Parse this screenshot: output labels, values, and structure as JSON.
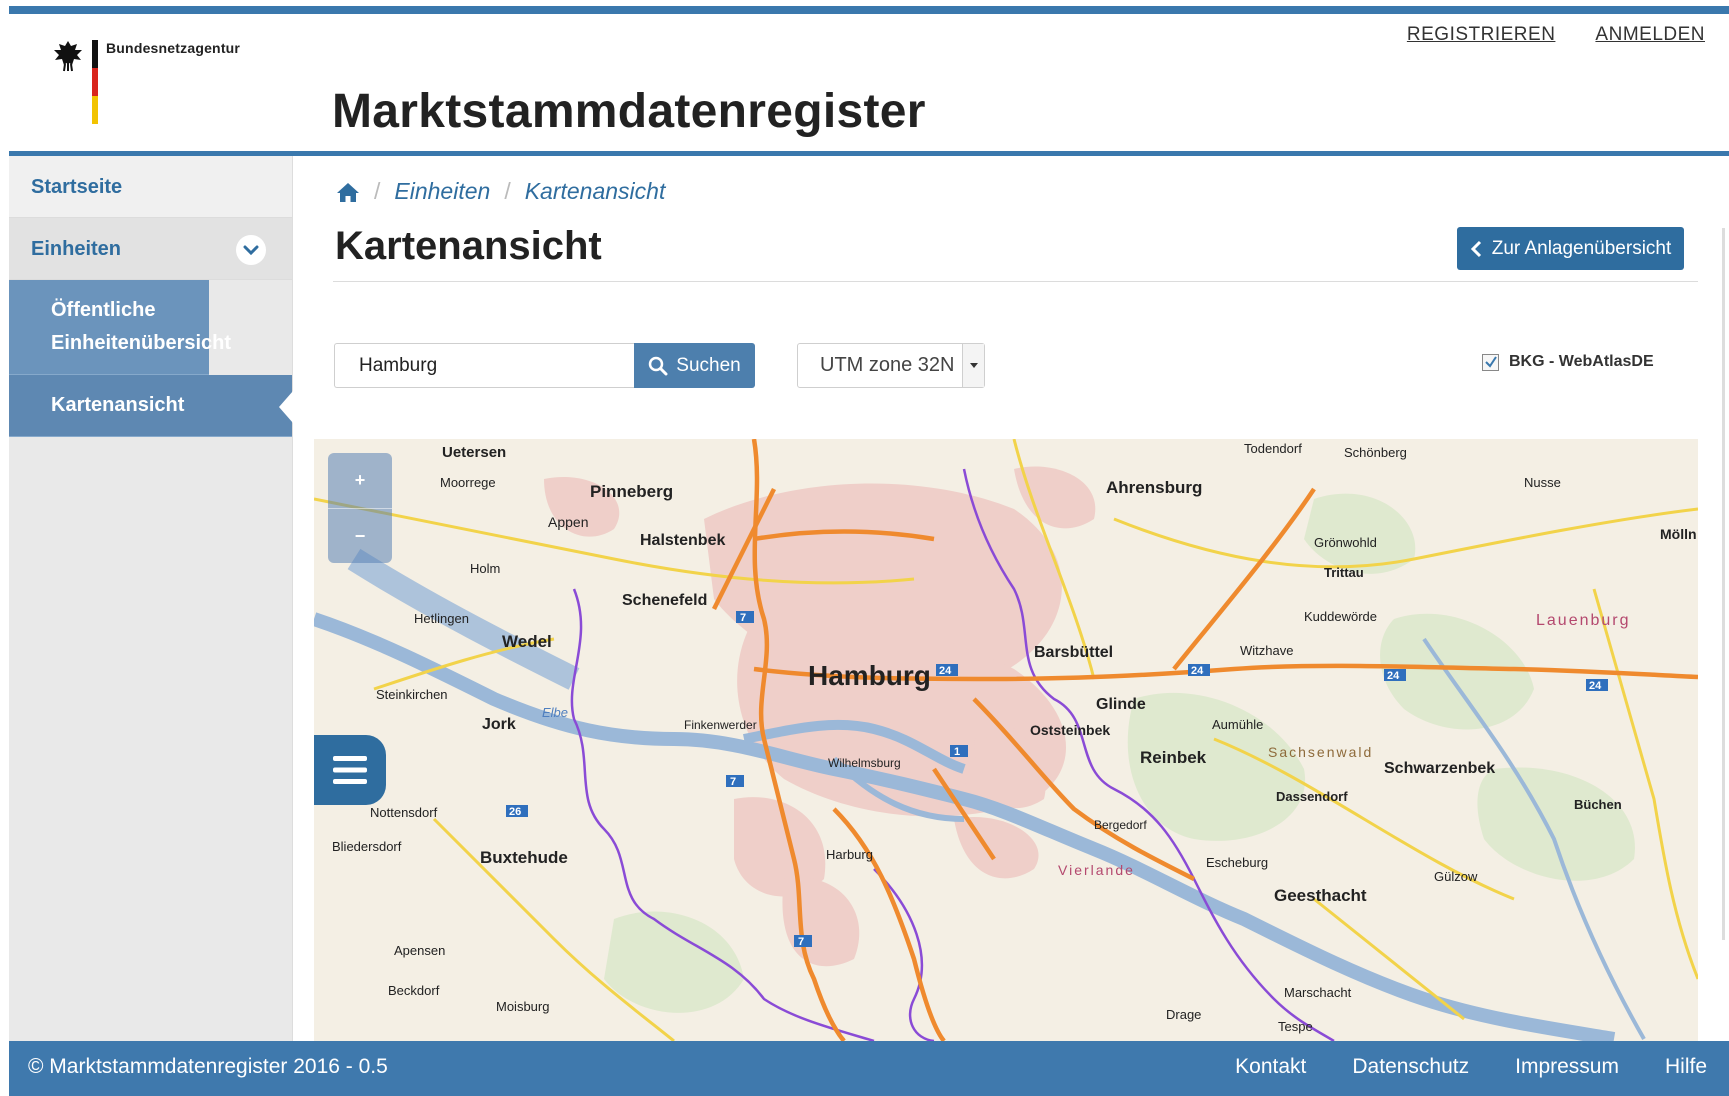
{
  "brand": {
    "agency": "Bundesnetzagentur",
    "app_title": "Marktstammdatenregister"
  },
  "top_links": [
    "REGISTRIEREN",
    "ANMELDEN"
  ],
  "sidebar": {
    "items": [
      {
        "label": "Startseite"
      },
      {
        "label": "Einheiten"
      }
    ],
    "subitems": [
      {
        "label": "Öffentliche Einheitenübersicht"
      },
      {
        "label": "Kartenansicht"
      }
    ]
  },
  "breadcrumb": [
    "Einheiten",
    "Kartenansicht"
  ],
  "page_title": "Kartenansicht",
  "back_button": "Zur Anlagenübersicht",
  "search": {
    "value": "Hamburg",
    "button": "Suchen"
  },
  "projection": {
    "selected": "UTM zone 32N"
  },
  "layer": {
    "label": "BKG - WebAtlasDE",
    "checked": true
  },
  "map": {
    "labels": {
      "hamburg": "Hamburg",
      "pinneberg": "Pinneberg",
      "halstenbek": "Halstenbek",
      "schenefeld": "Schenefeld",
      "wedel": "Wedel",
      "uetersen": "Uetersen",
      "ahrensburg": "Ahrensburg",
      "barsbuettel": "Barsbüttel",
      "glinde": "Glinde",
      "reinbek": "Reinbek",
      "oststeinbek": "Oststeinbek",
      "schwarzenbek": "Schwarzenbek",
      "geesthacht": "Geesthacht",
      "buxtehude": "Buxtehude",
      "jork": "Jork",
      "lauenburg": "Lauenburg",
      "sachsenwald": "Sachsenwald",
      "vierlande": "Vierlande",
      "harburg": "Harburg",
      "wilhelmsburg": "Wilhelmsburg",
      "finkenwerder": "Finkenwerder",
      "trittau": "Trittau",
      "dassendorf": "Dassendorf",
      "moisburg": "Moisburg",
      "appen": "Appen",
      "holm": "Holm",
      "nottensdorf": "Nottensdorf",
      "apensen": "Apensen",
      "beckdorf": "Beckdorf",
      "buechen": "Büchen",
      "moelln": "Mölln",
      "escheburg": "Escheburg",
      "bergedorf": "Bergedorf",
      "witzhave": "Witzhave",
      "aumuehle": "Aumühle",
      "gruenwohld": "Grönwohld",
      "schoenberg": "Schönberg",
      "todendorf": "Todendorf",
      "nusse": "Nusse",
      "steinkirchen": "Steinkirchen",
      "bliedersdorf": "Bliedersdorf",
      "drage": "Drage",
      "tespe": "Tespe",
      "marschacht": "Marschacht",
      "guelzow": "Gülzow",
      "hetlingen": "Hetlingen",
      "moorrege": "Moorrege",
      "kuddewoerde": "Kuddewörde",
      "elbe": "Elbe"
    }
  },
  "footer": {
    "copyright": "© Marktstammdatenregister 2016 - 0.5",
    "links": [
      "Kontakt",
      "Datenschutz",
      "Impressum",
      "Hilfe"
    ]
  },
  "colors": {
    "primary": "#3a78ad",
    "sidebar_sub": "#6b94bc",
    "footer": "#3f79ad"
  }
}
